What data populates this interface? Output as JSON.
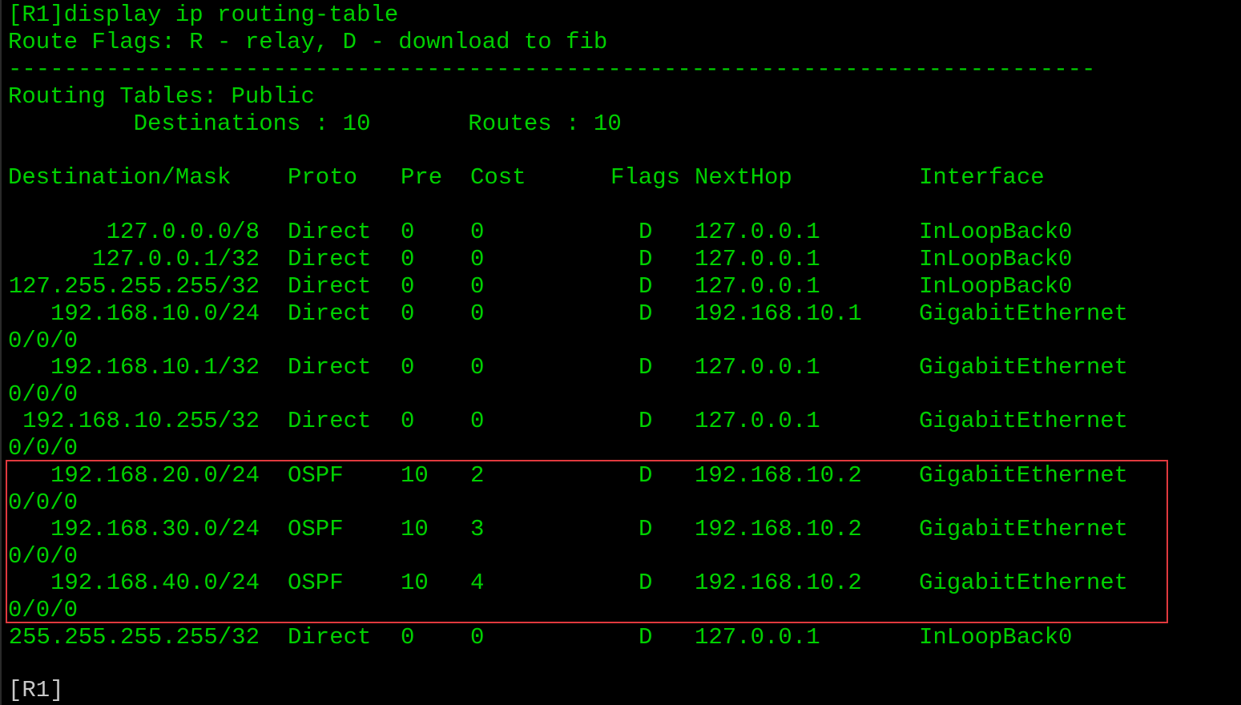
{
  "terminal": {
    "command": "[R1]display ip routing-table",
    "route_flags": "Route Flags: R - relay, D - download to fib",
    "separator": "------------------------------------------------------------------------------",
    "tables_title": "Routing Tables: Public",
    "summary": "         Destinations : 10       Routes : 10",
    "headers": {
      "dest": "Destination/Mask",
      "proto": "Proto",
      "pre": "Pre",
      "cost": "Cost",
      "flags": "Flags",
      "nexthop": "NextHop",
      "iface": "Interface"
    },
    "routes": [
      {
        "dest": "127.0.0.0/8",
        "proto": "Direct",
        "pre": "0",
        "cost": "0",
        "flags": "D",
        "nexthop": "127.0.0.1",
        "iface": "InLoopBack0",
        "iface_cont": ""
      },
      {
        "dest": "127.0.0.1/32",
        "proto": "Direct",
        "pre": "0",
        "cost": "0",
        "flags": "D",
        "nexthop": "127.0.0.1",
        "iface": "InLoopBack0",
        "iface_cont": ""
      },
      {
        "dest": "127.255.255.255/32",
        "proto": "Direct",
        "pre": "0",
        "cost": "0",
        "flags": "D",
        "nexthop": "127.0.0.1",
        "iface": "InLoopBack0",
        "iface_cont": ""
      },
      {
        "dest": "192.168.10.0/24",
        "proto": "Direct",
        "pre": "0",
        "cost": "0",
        "flags": "D",
        "nexthop": "192.168.10.1",
        "iface": "GigabitEthernet",
        "iface_cont": "0/0/0"
      },
      {
        "dest": "192.168.10.1/32",
        "proto": "Direct",
        "pre": "0",
        "cost": "0",
        "flags": "D",
        "nexthop": "127.0.0.1",
        "iface": "GigabitEthernet",
        "iface_cont": "0/0/0"
      },
      {
        "dest": "192.168.10.255/32",
        "proto": "Direct",
        "pre": "0",
        "cost": "0",
        "flags": "D",
        "nexthop": "127.0.0.1",
        "iface": "GigabitEthernet",
        "iface_cont": "0/0/0"
      },
      {
        "dest": "192.168.20.0/24",
        "proto": "OSPF",
        "pre": "10",
        "cost": "2",
        "flags": "D",
        "nexthop": "192.168.10.2",
        "iface": "GigabitEthernet",
        "iface_cont": "0/0/0"
      },
      {
        "dest": "192.168.30.0/24",
        "proto": "OSPF",
        "pre": "10",
        "cost": "3",
        "flags": "D",
        "nexthop": "192.168.10.2",
        "iface": "GigabitEthernet",
        "iface_cont": "0/0/0"
      },
      {
        "dest": "192.168.40.0/24",
        "proto": "OSPF",
        "pre": "10",
        "cost": "4",
        "flags": "D",
        "nexthop": "192.168.10.2",
        "iface": "GigabitEthernet",
        "iface_cont": "0/0/0"
      },
      {
        "dest": "255.255.255.255/32",
        "proto": "Direct",
        "pre": "0",
        "cost": "0",
        "flags": "D",
        "nexthop": "127.0.0.1",
        "iface": "InLoopBack0",
        "iface_cont": ""
      }
    ],
    "prompt": "[R1]"
  },
  "colors": {
    "background": "#000000",
    "text": "#00d000",
    "prompt": "#c8c8c8",
    "highlight": "#e0393e"
  }
}
